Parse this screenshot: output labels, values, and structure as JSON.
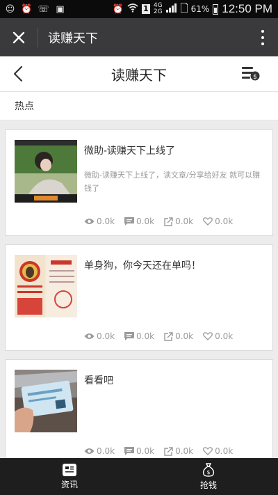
{
  "status_bar": {
    "network": "4G",
    "network2": "2G",
    "battery": "61%",
    "time": "12:50 PM"
  },
  "top_bar": {
    "title": "读赚天下"
  },
  "page_header": {
    "title": "读赚天下"
  },
  "tabs": [
    {
      "label": "热点"
    }
  ],
  "articles": [
    {
      "title": "微助-读赚天下上线了",
      "desc": "微助-读赚天下上线了，读文章/分享给好友 就可以赚钱了",
      "views": "0.0k",
      "comments": "0.0k",
      "shares": "0.0k",
      "likes": "0.0k"
    },
    {
      "title": "单身狗，你今天还在单吗！",
      "desc": "",
      "views": "0.0k",
      "comments": "0.0k",
      "shares": "0.0k",
      "likes": "0.0k"
    },
    {
      "title": "看看吧",
      "desc": "",
      "views": "0.0k",
      "comments": "0.0k",
      "shares": "0.0k",
      "likes": "0.0k"
    }
  ],
  "bottom_nav": [
    {
      "label": "资讯",
      "icon": "news-icon"
    },
    {
      "label": "抢钱",
      "icon": "money-bag-icon"
    }
  ],
  "colors": {
    "top_bar_bg": "#3a3a3c",
    "bottom_nav_bg": "#1e1e1e",
    "page_bg": "#ececec"
  }
}
